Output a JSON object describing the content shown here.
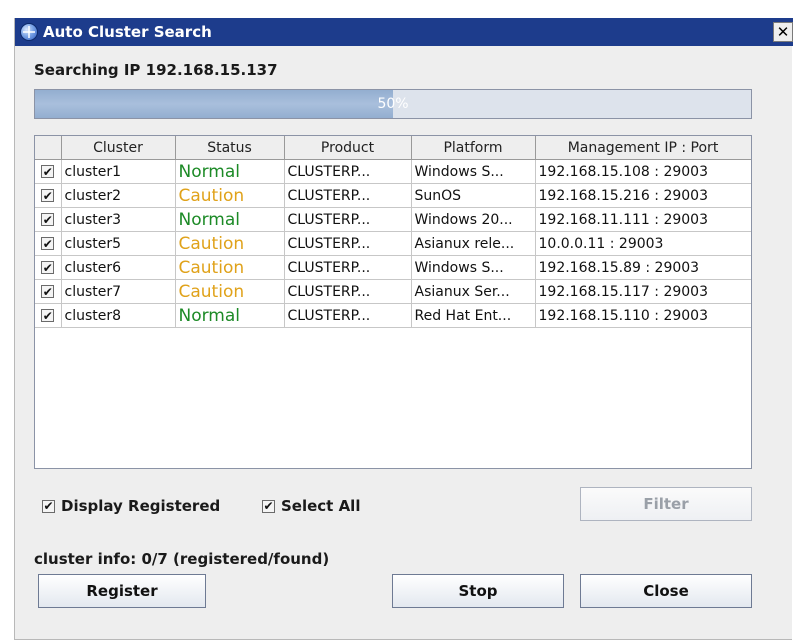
{
  "window": {
    "title": "Auto Cluster Search",
    "close_symbol": "✕"
  },
  "searching": "Searching IP 192.168.15.137",
  "progress": {
    "percent": 50,
    "text": "50%"
  },
  "table": {
    "columns": [
      "",
      "Cluster",
      "Status",
      "Product",
      "Platform",
      "Management IP : Port"
    ],
    "rows": [
      {
        "checked": true,
        "cluster": "cluster1",
        "status": "Normal",
        "status_type": "normal",
        "product": "CLUSTERP...",
        "platform": "Windows S...",
        "ip": "192.168.15.108 : 29003"
      },
      {
        "checked": true,
        "cluster": "cluster2",
        "status": "Caution",
        "status_type": "caution",
        "product": "CLUSTERP...",
        "platform": "SunOS",
        "ip": "192.168.15.216 : 29003"
      },
      {
        "checked": true,
        "cluster": "cluster3",
        "status": "Normal",
        "status_type": "normal",
        "product": "CLUSTERP...",
        "platform": "Windows 20...",
        "ip": "192.168.11.111 : 29003"
      },
      {
        "checked": true,
        "cluster": "cluster5",
        "status": "Caution",
        "status_type": "caution",
        "product": "CLUSTERP...",
        "platform": "Asianux rele...",
        "ip": "10.0.0.11 : 29003"
      },
      {
        "checked": true,
        "cluster": "cluster6",
        "status": "Caution",
        "status_type": "caution",
        "product": "CLUSTERP...",
        "platform": "Windows S...",
        "ip": "192.168.15.89 : 29003"
      },
      {
        "checked": true,
        "cluster": "cluster7",
        "status": "Caution",
        "status_type": "caution",
        "product": "CLUSTERP...",
        "platform": "Asianux Ser...",
        "ip": "192.168.15.117 : 29003"
      },
      {
        "checked": true,
        "cluster": "cluster8",
        "status": "Normal",
        "status_type": "normal",
        "product": "CLUSTERP...",
        "platform": "Red Hat Ent...",
        "ip": "192.168.15.110 : 29003"
      }
    ]
  },
  "options": {
    "display_registered": {
      "label": "Display Registered",
      "checked": true
    },
    "select_all": {
      "label": "Select All",
      "checked": true
    }
  },
  "check_mark": "✔",
  "buttons": {
    "filter": "Filter",
    "register": "Register",
    "stop": "Stop",
    "close": "Close"
  },
  "cluster_info": "cluster info: 0/7 (registered/found)",
  "colors": {
    "title_bar": "#1d3c8c",
    "status_normal": "#1c8a26",
    "status_caution": "#e0a21a",
    "progress_fill": "#a3b9d8"
  },
  "icons": {
    "app": "globe-icon",
    "close": "close-icon",
    "checkbox": "checkbox-icon"
  }
}
